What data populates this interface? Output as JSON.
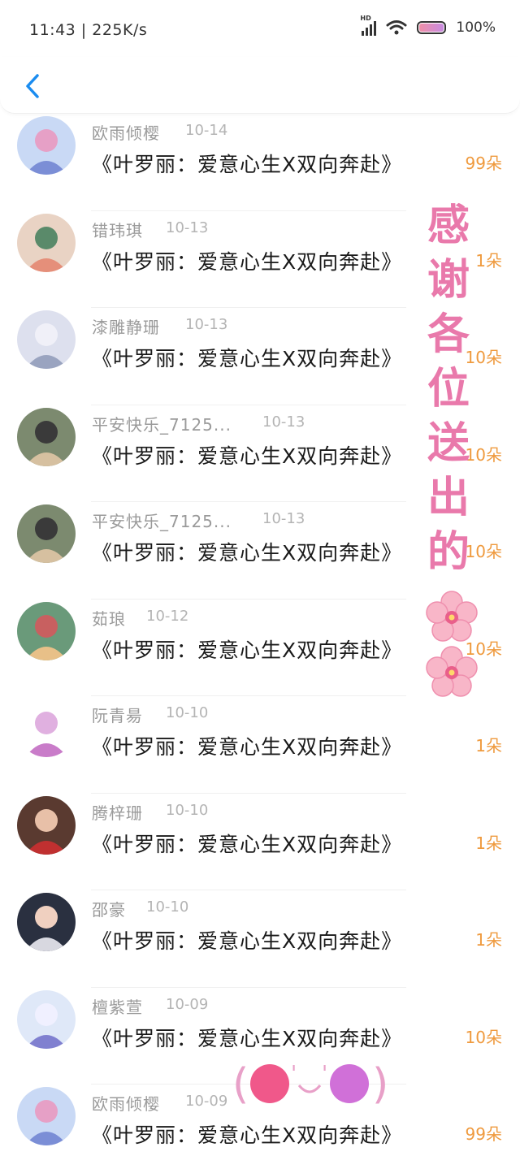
{
  "status_bar": {
    "time_speed": "11:43 | 225K/s",
    "network_label": "HD",
    "battery": "100%",
    "battery_level": 1.0
  },
  "header": {
    "back_icon": "chevron-left-icon"
  },
  "gifts": [
    {
      "name": "欧雨倾樱",
      "date": "10-14",
      "title": "《叶罗丽：爱意心生X双向奔赴》",
      "count": "99朵"
    },
    {
      "name": "错玮琪",
      "date": "10-13",
      "title": "《叶罗丽：爱意心生X双向奔赴》",
      "count": "1朵"
    },
    {
      "name": "漆雕静珊",
      "date": "10-13",
      "title": "《叶罗丽：爱意心生X双向奔赴》",
      "count": "10朵"
    },
    {
      "name": "平安快乐_7125...",
      "date": "10-13",
      "title": "《叶罗丽：爱意心生X双向奔赴》",
      "count": "10朵"
    },
    {
      "name": "平安快乐_7125...",
      "date": "10-13",
      "title": "《叶罗丽：爱意心生X双向奔赴》",
      "count": "10朵"
    },
    {
      "name": "茹琅",
      "date": "10-12",
      "title": "《叶罗丽：爱意心生X双向奔赴》",
      "count": "10朵"
    },
    {
      "name": "阮青昜",
      "date": "10-10",
      "title": "《叶罗丽：爱意心生X双向奔赴》",
      "count": "1朵"
    },
    {
      "name": "腾梓珊",
      "date": "10-10",
      "title": "《叶罗丽：爱意心生X双向奔赴》",
      "count": "1朵"
    },
    {
      "name": "邵豪",
      "date": "10-10",
      "title": "《叶罗丽：爱意心生X双向奔赴》",
      "count": "1朵"
    },
    {
      "name": "檀紫萱",
      "date": "10-09",
      "title": "《叶罗丽：爱意心生X双向奔赴》",
      "count": "10朵"
    },
    {
      "name": "欧雨倾樱",
      "date": "10-09",
      "title": "《叶罗丽：爱意心生X双向奔赴》",
      "count": "99朵"
    }
  ],
  "overlay": {
    "chars": [
      "感",
      "谢",
      "各",
      "位",
      "送",
      "出",
      "的"
    ],
    "kaomoji": "(●'◡'●)"
  },
  "colors": {
    "accent": "#1a8cf0",
    "count": "#ef9a3e",
    "overlay": "#e979ab"
  }
}
